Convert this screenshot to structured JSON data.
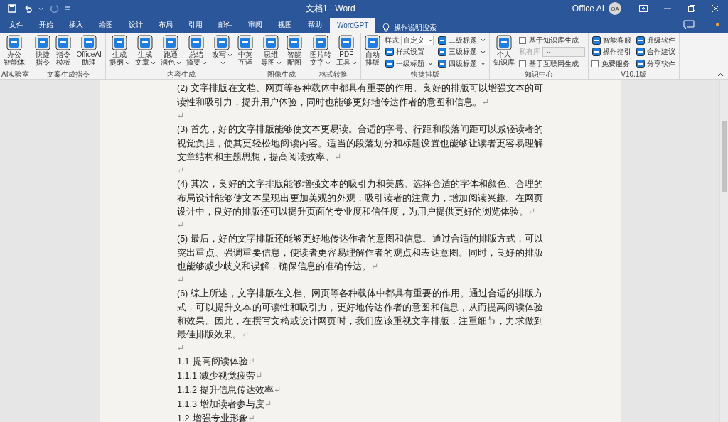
{
  "window": {
    "title": "文档1 - Word",
    "account": "Office AI",
    "avatar": "OA"
  },
  "tabs": [
    {
      "label": "文件",
      "selected": false
    },
    {
      "label": "开始",
      "selected": false
    },
    {
      "label": "插入",
      "selected": false
    },
    {
      "label": "绘图",
      "selected": false
    },
    {
      "label": "设计",
      "selected": false
    },
    {
      "label": "布局",
      "selected": false
    },
    {
      "label": "引用",
      "selected": false
    },
    {
      "label": "邮件",
      "selected": false
    },
    {
      "label": "审阅",
      "selected": false
    },
    {
      "label": "视图",
      "selected": false
    },
    {
      "label": "帮助",
      "selected": false
    },
    {
      "label": "WordGPT",
      "selected": true
    }
  ],
  "search": {
    "placeholder": "操作说明搜索"
  },
  "ribbon": {
    "groups": [
      {
        "label": "AI实验室",
        "columns": [
          [
            {
              "kind": "large",
              "label": [
                "办公",
                "智能体"
              ],
              "dropdown": false
            }
          ]
        ]
      },
      {
        "label": "文案生成指令",
        "columns": [
          [
            {
              "kind": "large",
              "label": [
                "快捷",
                "指令"
              ],
              "dropdown": false
            }
          ],
          [
            {
              "kind": "large",
              "label": [
                "指令",
                "模板"
              ],
              "dropdown": false
            }
          ],
          [
            {
              "kind": "large",
              "label": [
                "OfficeAI",
                "助理"
              ],
              "dropdown": false
            }
          ]
        ]
      },
      {
        "label": "内容生成",
        "columns": [
          [
            {
              "kind": "large",
              "label": [
                "生成",
                "提纲"
              ],
              "dropdown": true
            }
          ],
          [
            {
              "kind": "large",
              "label": [
                "生成",
                "文章"
              ],
              "dropdown": true
            }
          ],
          [
            {
              "kind": "large",
              "label": [
                "跑通",
                "润色"
              ],
              "dropdown": true
            }
          ],
          [
            {
              "kind": "large",
              "label": [
                "总结",
                "摘要"
              ],
              "dropdown": true
            }
          ],
          [
            {
              "kind": "large",
              "label": [
                "改写"
              ],
              "dropdown": true
            }
          ],
          [
            {
              "kind": "large",
              "label": [
                "中英",
                "互译"
              ],
              "dropdown": false
            }
          ]
        ]
      },
      {
        "label": "图像生成",
        "columns": [
          [
            {
              "kind": "large",
              "label": [
                "思维",
                "导图"
              ],
              "dropdown": true
            }
          ],
          [
            {
              "kind": "large",
              "label": [
                "智能",
                "配图"
              ],
              "dropdown": false
            }
          ]
        ]
      },
      {
        "label": "格式转换",
        "columns": [
          [
            {
              "kind": "large",
              "label": [
                "图片转",
                "文字"
              ],
              "dropdown": true
            }
          ],
          [
            {
              "kind": "large",
              "label": [
                "PDF",
                "工具"
              ],
              "dropdown": true
            }
          ]
        ]
      },
      {
        "label": "快捷排版",
        "columns": [
          [
            {
              "kind": "large",
              "label": [
                "自动",
                "排版"
              ],
              "dropdown": false
            }
          ],
          [
            {
              "kind": "combo",
              "label": "样式",
              "value": "自定义"
            },
            {
              "kind": "small",
              "label": "样式设置",
              "dropdown": false
            },
            {
              "kind": "small",
              "label": "一级标题",
              "dropdown": true
            }
          ],
          [
            {
              "kind": "small",
              "label": "二级标题",
              "dropdown": true
            },
            {
              "kind": "small",
              "label": "三级标题",
              "dropdown": true
            },
            {
              "kind": "small",
              "label": "四级标题",
              "dropdown": true
            }
          ]
        ]
      },
      {
        "label": "知识中心",
        "columns": [
          [
            {
              "kind": "large",
              "label": [
                "个人",
                "知识库"
              ],
              "dropdown": false
            }
          ],
          [
            {
              "kind": "check",
              "label": "基于知识库生成",
              "checked": false
            },
            {
              "kind": "combo",
              "label": "私有库",
              "disabled": true
            },
            {
              "kind": "check",
              "label": "基于互联网生成",
              "checked": false
            }
          ]
        ]
      },
      {
        "label": "V10.1版",
        "columns": [
          [
            {
              "kind": "small",
              "label": "智能客服",
              "dropdown": false
            },
            {
              "kind": "small",
              "label": "操作指引",
              "dropdown": false
            },
            {
              "kind": "check",
              "label": "免费服务",
              "checked": false
            }
          ],
          [
            {
              "kind": "small",
              "label": "升级软件",
              "dropdown": false
            },
            {
              "kind": "small",
              "label": "合作建议",
              "dropdown": false
            },
            {
              "kind": "small",
              "label": "分享软件",
              "dropdown": false
            }
          ]
        ]
      }
    ]
  },
  "document": {
    "paragraphs": [
      {
        "kind": "numbered",
        "number": "(2)",
        "text": "文字排版在文档、网页等各种载体中都具有重要的作用。良好的排版可以增强文本的可读性和吸引力，提升用户体验，同时也能够更好地传达作者的意图和信息。↵"
      },
      {
        "kind": "empty",
        "text": "↵"
      },
      {
        "kind": "numbered",
        "number": "(3)",
        "text": "首先，好的文字排版能够使文本更易读。合适的字号、行距和段落间距可以减轻读者的视觉负担，使其更轻松地阅读内容。适当的段落划分和标题设置也能够让读者更容易理解文章结构和主题思想，提高阅读效率。↵"
      },
      {
        "kind": "empty",
        "text": "↵"
      },
      {
        "kind": "numbered",
        "number": "(4)",
        "text": "其次，良好的文字排版能够增强文本的吸引力和美感。选择合适的字体和颜色、合理的布局设计能够使文本呈现出更加美观的外观，吸引读者的注意力，增加阅读兴趣。在网页设计中，良好的排版还可以提升页面的专业度和信任度，为用户提供更好的浏览体验。↵"
      },
      {
        "kind": "empty",
        "text": "↵"
      },
      {
        "kind": "numbered",
        "number": "(5)",
        "text": "最后，好的文字排版还能够更好地传达作者的意图和信息。通过合适的排版方式，可以突出重点、强调重要信息，使读者更容易理解作者的观点和表达意图。同时，良好的排版也能够减少歧义和误解，确保信息的准确传达。↵"
      },
      {
        "kind": "empty",
        "text": "↵"
      },
      {
        "kind": "numbered",
        "number": "(6)",
        "text": "综上所述，文字排版在文档、网页等各种载体中都具有重要的作用。通过合适的排版方式，可以提升文本的可读性和吸引力，更好地传达作者的意图和信息，从而提高阅读体验和效果。因此，在撰写文稿或设计网页时，我们应该重视文字排版，注重细节，力求做到最佳排版效果。↵"
      },
      {
        "kind": "empty",
        "text": "↵"
      },
      {
        "kind": "heading",
        "number": "1.1",
        "text": "提高阅读体验↵"
      },
      {
        "kind": "heading",
        "number": "1.1.1",
        "text": "减少视觉疲劳↵"
      },
      {
        "kind": "heading",
        "number": "1.1.2",
        "text": "提升信息传达效率↵"
      },
      {
        "kind": "heading",
        "number": "1.1.3",
        "text": "增加读者参与度↵"
      },
      {
        "kind": "heading",
        "number": "1.2",
        "text": "增强专业形象↵"
      }
    ]
  }
}
